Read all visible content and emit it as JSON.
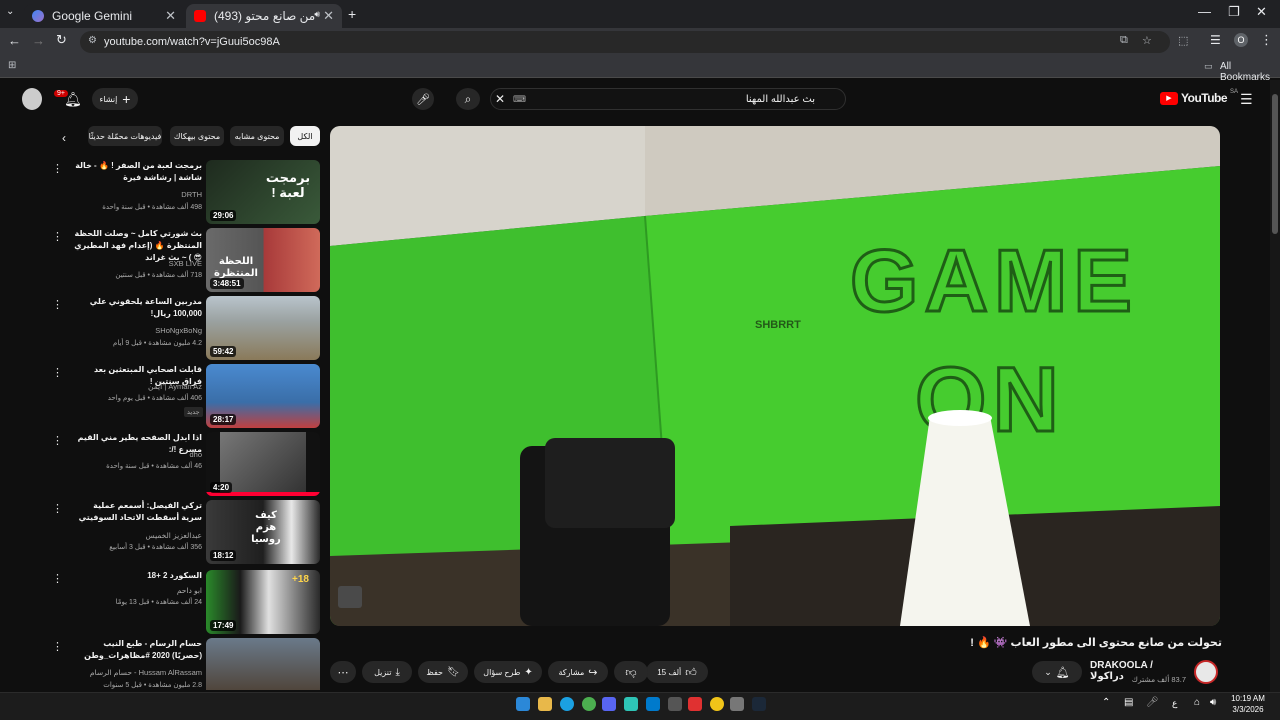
{
  "browser": {
    "tabs": [
      {
        "title": "Google Gemini",
        "active": false
      },
      {
        "title": "(493) تحولت من صانع محتو",
        "active": true
      }
    ],
    "url": "youtube.com/watch?v=jGuui5oc98A",
    "bookmarks_label": "All Bookmarks",
    "profile_initial": "O"
  },
  "header": {
    "logo_text": "YouTube",
    "logo_region": "SA",
    "create_label": "إنشاء",
    "notif_count": "9+",
    "search_query": "بث عبدالله المهنا",
    "search_clear_icon": "close-icon",
    "keyboard_icon": "keyboard-icon"
  },
  "chips": [
    "الكل",
    "محتوى مشابه",
    "محتوى بيهكاك",
    "فيديوهات محمّلة حديثًا"
  ],
  "recommendations": [
    {
      "title": "برمجت لعبة من الصفر ! 🔥 - خالة شاشة | رشاشة فيرة",
      "channel": "DRTH",
      "meta": "498 ألف مشاهدة • قبل سنة واحدة",
      "duration": "29:06",
      "thumb_text": "برمجت لعبة !",
      "thumb_color": "#2a3a2a"
    },
    {
      "title": "بث شورتي كامل ~ وصلت اللحظة المنتظرة 🔥 (إعدام فهد المطيري 😎 ) ~ بث غراند",
      "channel": "SXB LIVE",
      "meta": "718 ألف مشاهدة • قبل سنتين",
      "duration": "3:48:51",
      "thumb_text": "اللحظة المنتظرة",
      "thumb_color": "#7a2b2b"
    },
    {
      "title": "مدربين الساعة يلحقوني علي 100,000 ريال!",
      "channel": "SHoNgxBoNg",
      "meta": "4.2 مليون مشاهدة • قبل 9 أيام",
      "duration": "59:42",
      "thumb_text": "",
      "thumb_color": "#8a7a5a"
    },
    {
      "title": "قابلت اصحابي المبتعثين بعد فراق سنتين !",
      "channel": "Ayman Az | أيمن",
      "meta": "406 ألف مشاهدة • قبل يوم واحد",
      "badge": "جديد",
      "duration": "28:17",
      "thumb_text": "",
      "thumb_color": "#3a6ea8"
    },
    {
      "title": "اذا ابدل الصفحه يطير مني القيم مسرع !/:",
      "channel": "dho",
      "meta": "46 ألف مشاهدة • قبل سنة واحدة",
      "duration": "4:20",
      "thumb_text": "",
      "thumb_color": "#555555"
    },
    {
      "title": "تركي الفيصل: أسمعم عملية سرية أسقطت الاتحاد السوفيتي",
      "channel": "عبدالعزيز الخميس",
      "meta": "356 ألف مشاهدة • قبل 3 أسابيع",
      "duration": "18:12",
      "thumb_text": "كيف هزم روسيا",
      "thumb_color": "#2b2b2b"
    },
    {
      "title": "السكورد 2 +18",
      "channel": "ابو داحم",
      "meta": "24 ألف مشاهدة • قبل 13 يومًا",
      "duration": "17:49",
      "thumb_text": "+18",
      "thumb_color": "#3a4a3a"
    },
    {
      "title": "حسام الرسام - طبع النيب (حصريًا) 2020 #مظاهرات_وطن",
      "channel": "Hussam AlRassam - حسام الرسام",
      "meta": "2.8 مليون مشاهدة • قبل 5 سنوات",
      "duration": "",
      "thumb_text": "",
      "thumb_color": "#4a3a2a"
    }
  ],
  "player": {
    "wall_text_1": "GAME",
    "wall_text_2": "ON",
    "small_wall_text": "SHBRRT"
  },
  "video": {
    "title": "تحولت من صانع محتوى الى مطور العاب 👾 🔥 !",
    "channel_name": "DRAKOOLA / دراكولا",
    "subscribers": "83.7 ألف مشترك",
    "likes": "15 ألف",
    "share_label": "مشاركة",
    "ask_label": "طرح سؤال",
    "save_label": "حفظ",
    "download_label": "تنزيل"
  },
  "taskbar": {
    "time": "10:19 AM",
    "date": "3/3/2026",
    "lang": "ع"
  }
}
